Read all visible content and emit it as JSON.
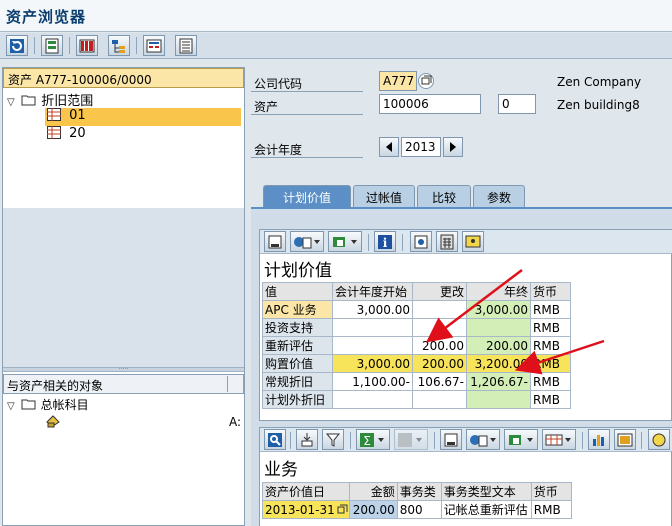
{
  "window": {
    "title": "资产浏览器"
  },
  "toolbar": {
    "buttons": [
      "refresh-icon",
      "layout-icon",
      "abc-icon",
      "tree-icon",
      "display-icon",
      "list-icon"
    ]
  },
  "left": {
    "asset_header": "资产 A777-100006/0000",
    "tree": {
      "root_label": "折旧范围",
      "items": [
        {
          "label": "01"
        },
        {
          "label": "20"
        }
      ]
    },
    "related": {
      "header": "与资产相关的对象",
      "root_label": "总帐科目",
      "child_value": "A:"
    }
  },
  "form": {
    "company_code_label": "公司代码",
    "company_code_value": "A777",
    "company_name": "Zen Company",
    "asset_label": "资产",
    "asset_main": "100006",
    "asset_sub": "0",
    "asset_desc": "Zen building8",
    "fiscal_year_label": "会计年度",
    "fiscal_year_value": "2013"
  },
  "tabs": [
    {
      "label": "计划价值",
      "active": true
    },
    {
      "label": "过帐值",
      "active": false
    },
    {
      "label": "比较",
      "active": false
    },
    {
      "label": "参数",
      "active": false
    }
  ],
  "planned_values": {
    "title": "计划价值",
    "columns": [
      "值",
      "会计年度开始",
      "更改",
      "年终",
      "货币"
    ],
    "rows": [
      {
        "name": "APC 业务",
        "start": "3,000.00",
        "change": "",
        "end": "3,000.00",
        "cur": "RMB"
      },
      {
        "name": "投资支持",
        "start": "",
        "change": "",
        "end": "",
        "cur": "RMB"
      },
      {
        "name": "重新评估",
        "start": "",
        "change": "200.00",
        "end": "200.00",
        "cur": "RMB"
      },
      {
        "name": "购置价值",
        "start": "3,000.00",
        "change": "200.00",
        "end": "3,200.00",
        "cur": "RMB"
      },
      {
        "name": "常规折旧",
        "start": "1,100.00-",
        "change": "106.67-",
        "end": "1,206.67-",
        "cur": "RMB"
      },
      {
        "name": "计划外折旧",
        "start": "",
        "change": "",
        "end": "",
        "cur": "RMB"
      }
    ]
  },
  "transactions": {
    "title": "业务",
    "columns": [
      "资产价值日",
      "金额",
      "事务类",
      "事务类型文本",
      "货币"
    ],
    "rows": [
      {
        "date": "2013-01-31",
        "amount": "200.00",
        "type": "800",
        "text": "记帐总重新评估",
        "cur": "RMB"
      }
    ]
  },
  "colors": {
    "accent": "#5b8fc5",
    "selection": "#f9c54a",
    "arrow": "#e0101a"
  }
}
